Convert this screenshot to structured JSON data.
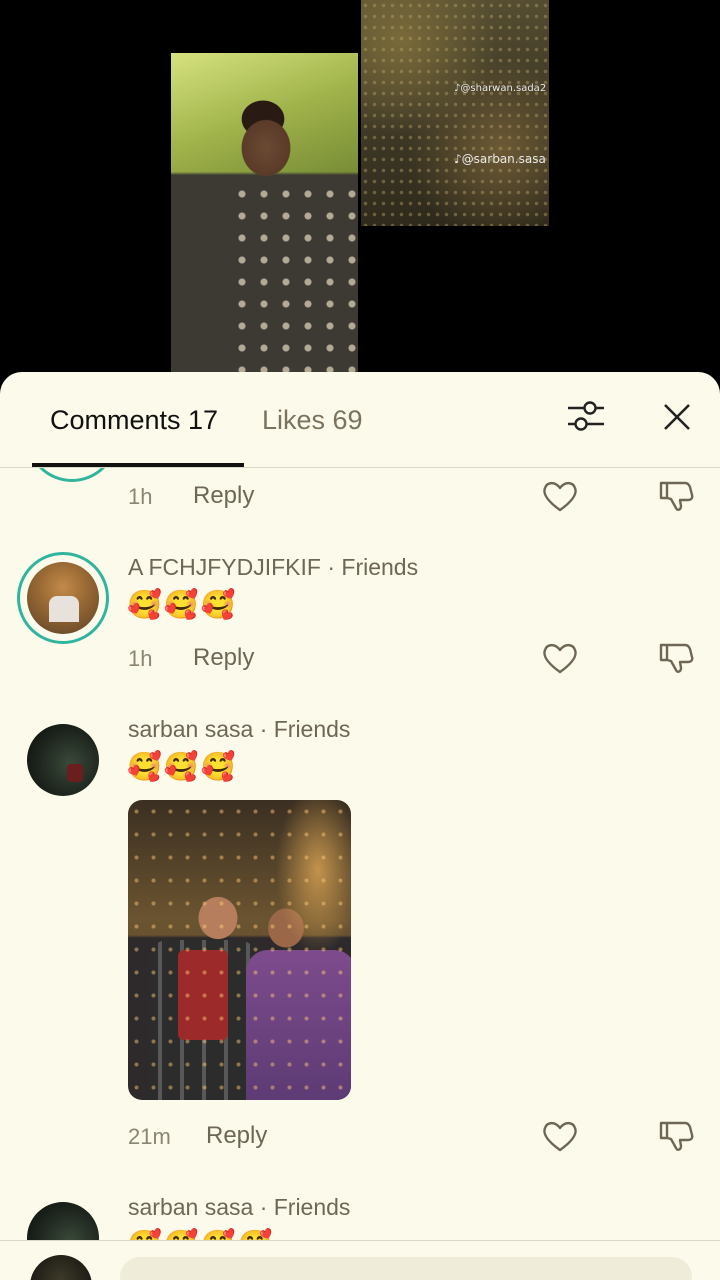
{
  "video": {
    "watermark_top": "@sharwan.sada2",
    "watermark_bottom": "@sarban.sasa"
  },
  "tabs": {
    "comments_label": "Comments 17",
    "likes_label": "Likes 69"
  },
  "comments": [
    {
      "time": "1h",
      "reply_label": "Reply"
    },
    {
      "name": "A FCHJFYDJIFKIF · Friends",
      "text": "🥰🥰🥰",
      "time": "1h",
      "reply_label": "Reply"
    },
    {
      "name": "sarban sasa · Friends",
      "text": "🥰🥰🥰",
      "time": "21m",
      "reply_label": "Reply"
    },
    {
      "name": "sarban sasa · Friends",
      "text": "🥰🥰🥰🥰"
    }
  ],
  "icons": {
    "filter": "sliders-icon",
    "close": "close-icon",
    "like": "heart-icon",
    "dislike": "thumbs-down-icon"
  },
  "colors": {
    "sheet_bg": "#fcfaea",
    "accent_ring": "#2fb59e",
    "text_muted": "#6f6755"
  }
}
